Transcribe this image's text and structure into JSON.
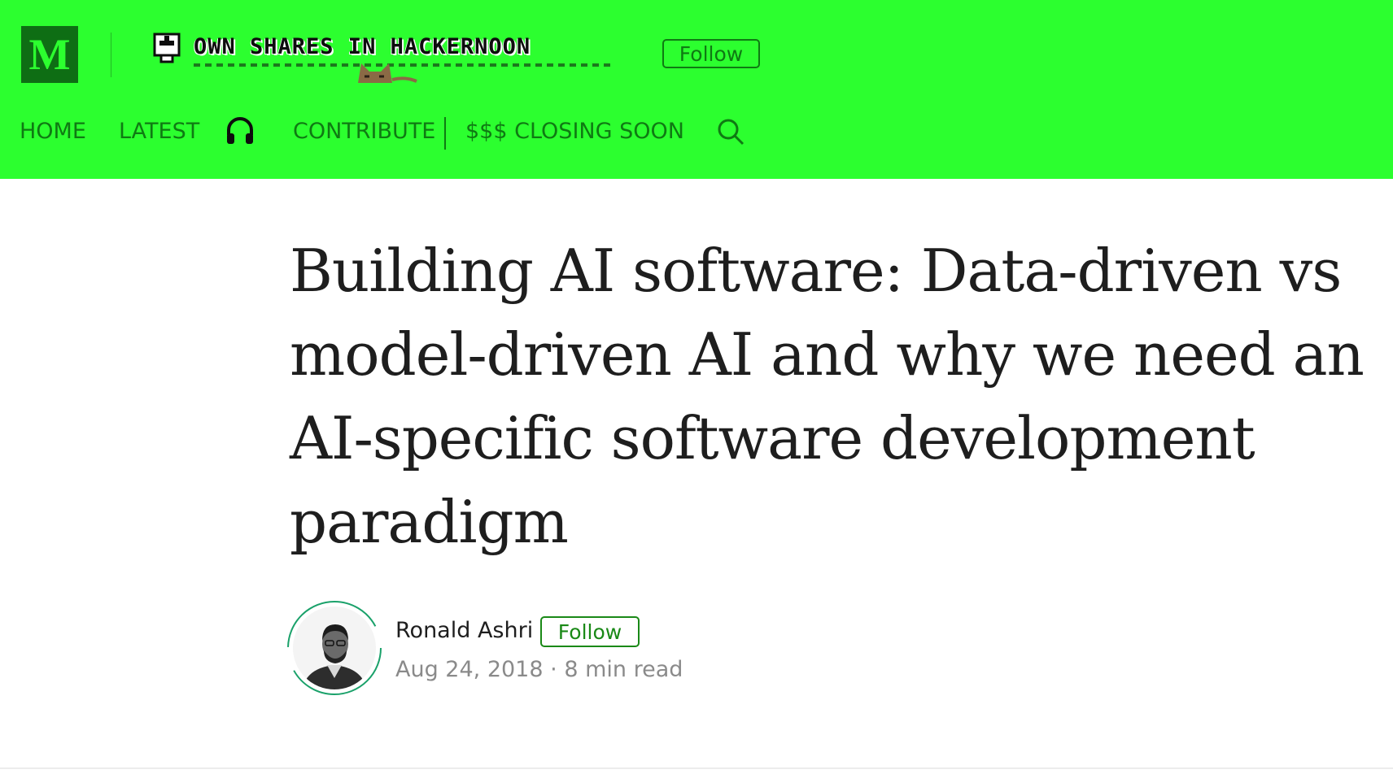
{
  "header": {
    "logo_letter": "M",
    "publication_title": "OWN SHARES IN HACKERNOON",
    "follow_label": "Follow",
    "background": "#2cff2f",
    "accent": "#0f7a13"
  },
  "nav": {
    "items": [
      {
        "label": "HOME"
      },
      {
        "label": "LATEST"
      },
      {
        "label": "CONTRIBUTE"
      },
      {
        "label": "$$$ CLOSING SOON"
      }
    ],
    "icons": [
      "headphones-icon",
      "search-icon"
    ]
  },
  "article": {
    "title": "Building AI software: Data-driven vs model-driven AI and why we need an AI-specific software development paradigm",
    "author": {
      "name": "Ronald Ashri",
      "follow_label": "Follow",
      "date": "Aug 24, 2018",
      "separator": "·",
      "read_time": "8 min read"
    }
  }
}
